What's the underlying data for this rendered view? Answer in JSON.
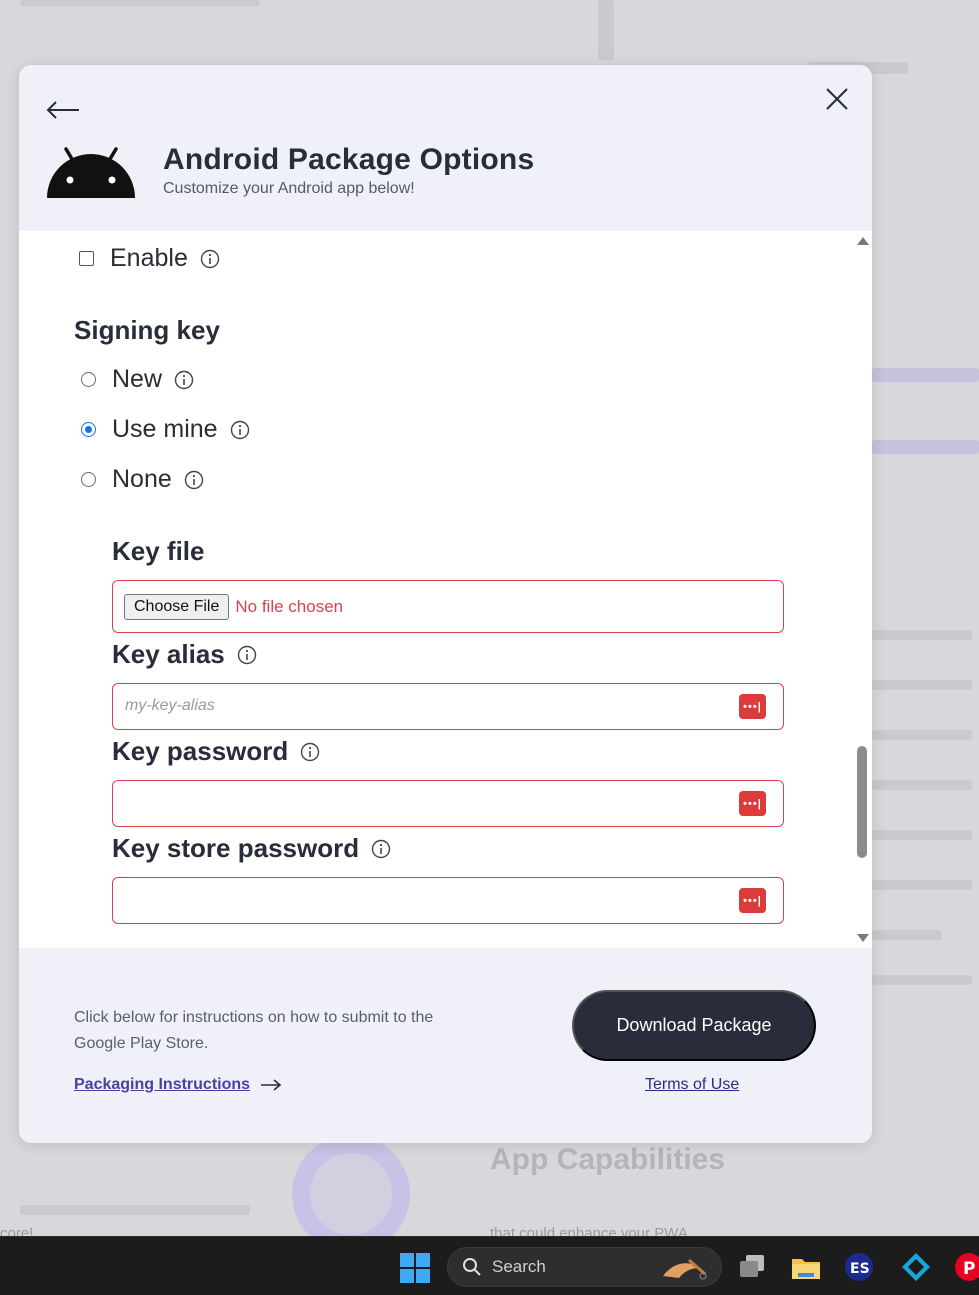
{
  "background": {
    "heading_partial": "App Capabilities",
    "text_partial_1": "core!",
    "text_partial_2": "that could enhance your PWA"
  },
  "modal": {
    "title": "Android Package Options",
    "subtitle": "Customize your Android app below!",
    "enable": {
      "label": "Enable",
      "checked": false
    },
    "signing_key": {
      "title": "Signing key",
      "options": [
        {
          "label": "New",
          "selected": false
        },
        {
          "label": "Use mine",
          "selected": true
        },
        {
          "label": "None",
          "selected": false
        }
      ]
    },
    "key_file": {
      "label": "Key file",
      "button": "Choose File",
      "status": "No file chosen"
    },
    "key_alias": {
      "label": "Key alias",
      "placeholder": "my-key-alias",
      "value": ""
    },
    "key_password": {
      "label": "Key password",
      "value": ""
    },
    "key_store_password": {
      "label": "Key store password",
      "value": ""
    },
    "footer": {
      "instructions": "Click below for instructions on how to submit to the Google Play Store.",
      "packaging_link": "Packaging Instructions",
      "download_button": "Download Package",
      "terms_link": "Terms of Use"
    }
  },
  "taskbar": {
    "search_label": "Search",
    "apps": [
      "task-view-icon",
      "file-explorer-icon",
      "es-app-icon",
      "kodi-icon",
      "pinterest-icon"
    ]
  },
  "colors": {
    "accent_dark": "#292c3a",
    "error_border": "#d9434e",
    "radio_selected": "#1473e6",
    "link_purple": "#4b3fa3",
    "modal_bg": "#f0f0f9"
  }
}
